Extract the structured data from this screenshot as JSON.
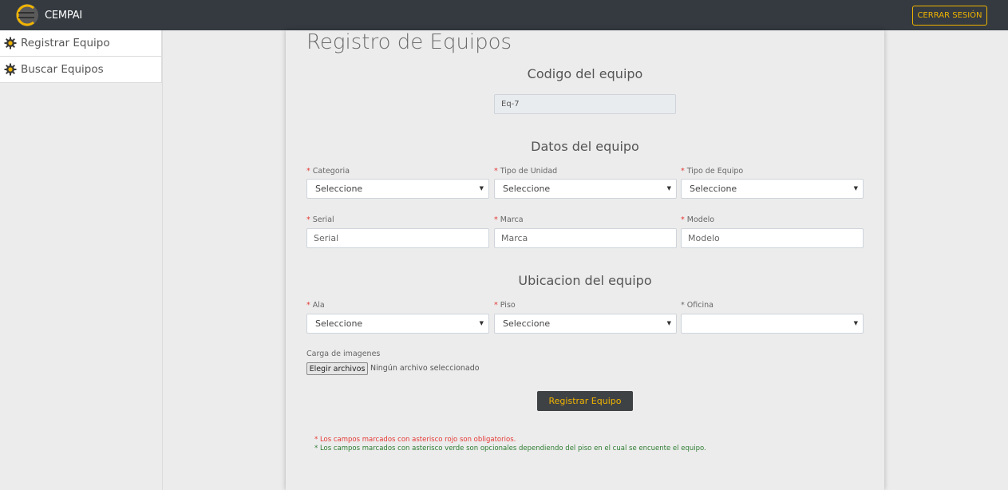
{
  "header": {
    "brand": "CEMPAI",
    "logout_label": "CERRAR SESIÓN"
  },
  "sidebar": {
    "items": [
      {
        "label": "Registrar Equipo",
        "icon": "gear-icon"
      },
      {
        "label": "Buscar Equipos",
        "icon": "gear-icon"
      }
    ]
  },
  "page": {
    "title": "Registro de Equipos"
  },
  "code_section": {
    "title": "Codigo del equipo",
    "value": "Eq-7"
  },
  "data_section": {
    "title": "Datos del equipo",
    "categoria": {
      "label": "Categoria",
      "value": "Seleccione"
    },
    "tipo_unidad": {
      "label": "Tipo de Unidad",
      "value": "Seleccione"
    },
    "tipo_equipo": {
      "label": "Tipo de Equipo",
      "value": "Seleccione"
    },
    "serial": {
      "label": "Serial",
      "placeholder": "Serial"
    },
    "marca": {
      "label": "Marca",
      "placeholder": "Marca"
    },
    "modelo": {
      "label": "Modelo",
      "placeholder": "Modelo"
    }
  },
  "location_section": {
    "title": "Ubicacion del equipo",
    "ala": {
      "label": "Ala",
      "value": "Seleccione"
    },
    "piso": {
      "label": "Piso",
      "value": "Seleccione"
    },
    "oficina": {
      "label": "Oficina",
      "value": ""
    }
  },
  "upload": {
    "label": "Carga de imagenes",
    "button": "Elegir archivos",
    "status": "Ningún archivo seleccionado"
  },
  "submit_label": "Registrar Equipo",
  "notes": {
    "required": "* Los campos marcados con asterisco rojo son obligatorios.",
    "optional": "* Los campos marcados con asterisco verde son opcionales dependiendo del piso en el cual se encuente el equipo."
  },
  "colors": {
    "accent": "#f0b400",
    "topbar": "#343a40",
    "required": "#e53935",
    "optional": "#2e7d32"
  }
}
